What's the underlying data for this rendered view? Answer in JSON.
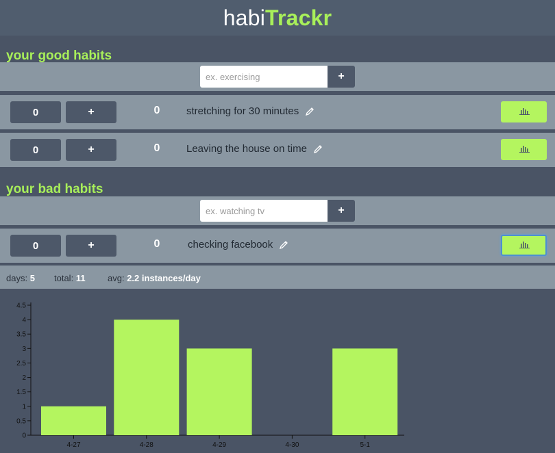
{
  "header": {
    "title_prefix": "habi",
    "title_accent": "Trackr"
  },
  "good_section": {
    "title": "your good habits",
    "input_placeholder": "ex. exercising",
    "add_label": "+",
    "habits": [
      {
        "count": "0",
        "plus": "+",
        "total": "0",
        "name": "stretching for 30 minutes"
      },
      {
        "count": "0",
        "plus": "+",
        "total": "0",
        "name": "Leaving the house on time"
      }
    ]
  },
  "bad_section": {
    "title": "your bad habits",
    "input_placeholder": "ex. watching tv",
    "add_label": "+",
    "habits": [
      {
        "count": "0",
        "plus": "+",
        "total": "0",
        "name": "checking facebook"
      }
    ]
  },
  "stats": {
    "days_label": "days:",
    "days_value": "5",
    "total_label": "total:",
    "total_value": "11",
    "avg_label": "avg:",
    "avg_value": "2.2 instances/day"
  },
  "colors": {
    "accent": "#a8ef5a",
    "bar": "#b4f55f",
    "button": "#4d5869"
  },
  "icons": {
    "edit": "pencil-icon",
    "chart": "bar-chart-icon"
  },
  "chart_data": {
    "type": "bar",
    "categories": [
      "4-27",
      "4-28",
      "4-29",
      "4-30",
      "5-1"
    ],
    "values": [
      1,
      4,
      3,
      0,
      3
    ],
    "ylim": [
      0,
      4.5
    ],
    "yticks": [
      "0",
      "0.5",
      "1",
      "1.5",
      "2",
      "2.5",
      "3",
      "3.5",
      "4",
      "4.5"
    ],
    "xlabel": "",
    "ylabel": ""
  }
}
